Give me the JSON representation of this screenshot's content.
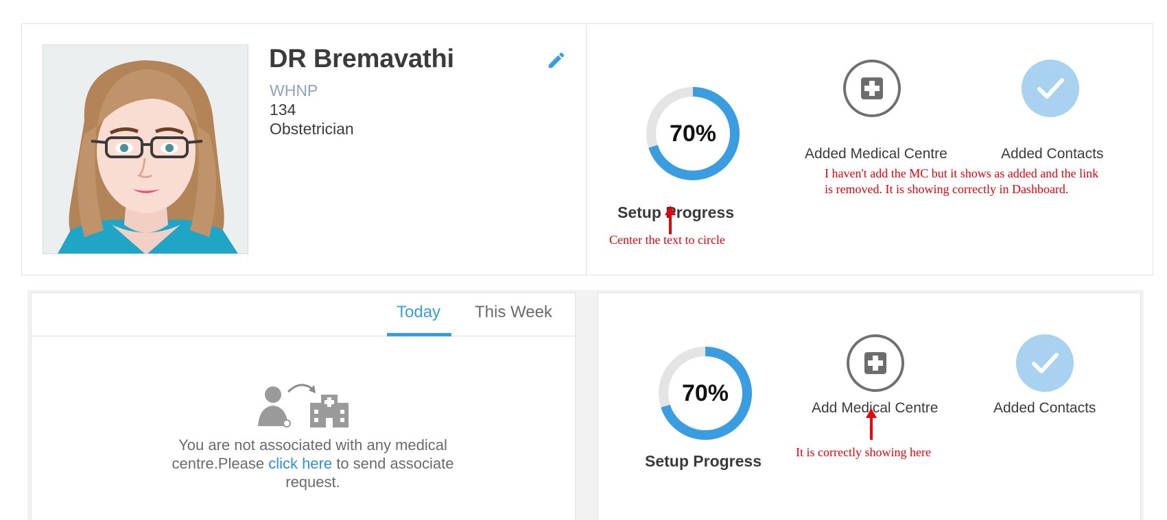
{
  "doctor": {
    "name": "DR Bremavathi",
    "title": "WHNP",
    "number": "134",
    "specialty": "Obstetrician"
  },
  "top_progress": {
    "percent_text": "70%",
    "percent_value": 70,
    "label": "Setup Progress",
    "steps": [
      {
        "label": "Added Medical Centre",
        "icon": "plus-icon",
        "state": "added"
      },
      {
        "label": "Added Contacts",
        "icon": "check-icon",
        "state": "added"
      }
    ]
  },
  "annotations": {
    "center_text": "Center the text to circle",
    "mc_issue_line1": "I haven't add the MC but it shows as added and the link",
    "mc_issue_line2": "is removed.   It is showing correctly in Dashboard.",
    "correct_here": "It is correctly showing here"
  },
  "tabs": [
    {
      "label": "Today",
      "active": true
    },
    {
      "label": "This Week",
      "active": false
    }
  ],
  "association": {
    "message_part1": "You are not associated with any medical centre.Please ",
    "link_text": "click here",
    "message_part2": " to send associate request."
  },
  "bottom_progress": {
    "percent_text": "70%",
    "percent_value": 70,
    "label": "Setup Progress",
    "steps": [
      {
        "label": "Add Medical Centre",
        "icon": "plus-icon",
        "state": "pending"
      },
      {
        "label": "Added Contacts",
        "icon": "check-icon",
        "state": "added"
      }
    ]
  },
  "colors": {
    "accent": "#3a9ddf",
    "ring_track": "#e4e4e4",
    "check_circle": "#a8d2ef",
    "annotation": "#e8000b"
  }
}
